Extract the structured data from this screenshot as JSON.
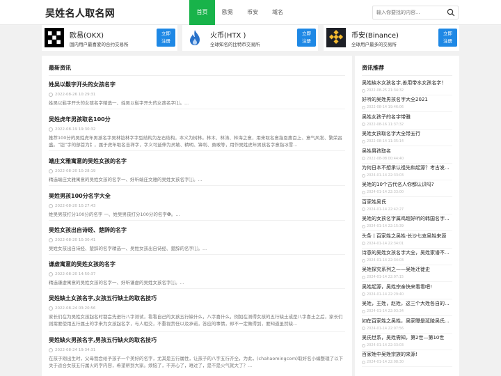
{
  "header": {
    "logo": "吴姓名人取名网",
    "nav": [
      "首页",
      "欧易",
      "币安",
      "域名"
    ],
    "search_placeholder": "输入你要找的内容..."
  },
  "exchanges": [
    {
      "name": "欧易(OKX)",
      "desc": "国内用户最喜爱的合约交易所",
      "button": [
        "立即",
        "注册"
      ],
      "icon": "okx-logo"
    },
    {
      "name": "火币(HTX )",
      "desc": "全球知名的比特币交易所",
      "button": [
        "立即",
        "注册"
      ],
      "icon": "htx-flame-logo"
    },
    {
      "name": "币安(Binance)",
      "desc": "全球用户最多的交易所",
      "button": [
        "立即",
        "注册"
      ],
      "icon": "binance-logo"
    }
  ],
  "colors": {
    "accent": "#18b34a",
    "button": "#1e88e5"
  },
  "latest": {
    "title": "最新资讯",
    "articles": [
      {
        "title": "姓吴以鬏字开头的女孩名字",
        "date": "2022-08-26 10:29:31",
        "desc": "姓吴以鬏字开头的女孩名字精选一、姓吴以鬏字开头的女孩名字⑴。..."
      },
      {
        "title": "吴姓虎年男孩取名100分",
        "date": "2022-08-19 19:30:32",
        "desc": "推荐100分的吴姓虎年男孩名字吴林铠林字字型结构为左右结构，本义为树林。林木、林涛、林海之意，用来取名意指恩惠百上、意气风发、繁荣昌盛。“铠”字的部首为钅，属于虎年取名吉祥字，字义可延伸为灵敏、精明、锋利、勇敢等，用作吴姓虎年男孩名字意指冰雪..."
      },
      {
        "title": "端庄文雅寓意的吴姓女孩的名字",
        "date": "2022-08-20 10:28:19",
        "desc": "精选端庄文雅寓意的吴姓女孩的名字一、好听端庄文雅的吴姓女孩名字⑴。..."
      },
      {
        "title": "吴姓男孩100分名字大全",
        "date": "2022-08-20 10:27:43",
        "desc": "姓吴男孩打分100分的名字 一、姓吴男孩打分100分的名字❶。..."
      },
      {
        "title": "吴姓女孩出自诗经、楚辞的名字",
        "date": "2022-08-20 10:30:41",
        "desc": "吴姓女孩出自诗经、楚辞的名字精选一、吴姓女孩出自诗经、楚辞的名字⑴。..."
      },
      {
        "title": "谦虚寓意的吴姓女孩的名字",
        "date": "2022-08-20 14:50:37",
        "desc": "精选谦虚寓意的吴姓女孩的名字一、好听谦虚的吴姓女孩名字⑴。..."
      },
      {
        "title": "吴姓缺土女孩名字,女孩五行缺土的取名技巧",
        "date": "2022-08-24 03:20:56",
        "desc": "家长们在为吴姓女孩起名时都会先进行八字测试，看看自己的女孩五行缺什么，八字喜什么，例如在测得女孩的五行缺土或是八字喜土之后，家长们则需要使用五行属土的字来为女孩起名字，与人相交，不重视责任以及承诺，答应的事情，却不一定做得到，要知道虽然缺..."
      },
      {
        "title": "吴姓缺火男孩名字,男孩五行缺火的取名技巧",
        "date": "2022-08-24 19:34:31",
        "desc": "在孩子刚出生时，父母我会给予孩子一个美好的名字，尤其是五行属性，让孩子的八字五行齐全，为此，(chahaomingcom)取好名小编整理了以下关于适合女孩五行属火的字内容，希望帮到大家。烦恼了，不开心了，难过了，是不是火气就大了？..."
      }
    ]
  },
  "recommend": {
    "title": "资讯推荐",
    "items": [
      {
        "title": "吴姓缺水女孩名字,善用带水女孩名字！",
        "date": "2022-08-25 21:34:32"
      },
      {
        "title": "好听的吴姓男孩名字大全2021",
        "date": "2022-08-14 19:46:06"
      },
      {
        "title": "吴姓女孩子的名字带雅",
        "date": "2022-08-16 11:37:32"
      },
      {
        "title": "吴姓女孩取名字大全带五行",
        "date": "2022-08-14 11:35:14"
      },
      {
        "title": "吴姓男孩取名",
        "date": "2022-08-08 00:44:40"
      },
      {
        "title": "为何日本不想承认祖先和起源？考古发...",
        "date": "2024-01-14 22:33:03"
      },
      {
        "title": "吴姓的10个古代名人你都认识吗?",
        "date": "2024-01-14 22:33:00"
      },
      {
        "title": "百家姓吴氏",
        "date": "2024-01-14 22:42:27"
      },
      {
        "title": "吴姓的女孩名字属鸡超好听的韩国名字...",
        "date": "2024-01-14 22:15:39"
      },
      {
        "title": "头条丨百家姓之吴姓·长沙七支吴姓来源",
        "date": "2024-01-14 22:34:01"
      },
      {
        "title": "诗意的吴姓女孩名字大全，吴姓家谱不...",
        "date": "2024-01-14 22:34:03"
      },
      {
        "title": "吴姓探究系列之——吴姓迁徙史",
        "date": "2024-01-14 22:07:15"
      },
      {
        "title": "吴姓起源，吴姓宗亲快来看看吧!",
        "date": "2024-01-14 22:29:40"
      },
      {
        "title": "吴姓，王姓，赵姓，这三个大姓各自的...",
        "date": "2024-01-14 22:03:34"
      },
      {
        "title": "如在百家姓之吴姓，吴家曝是延陵吴氏...",
        "date": "2024-01-14 22:07:56"
      },
      {
        "title": "吴氏世系，吴姓需知，第2世—第10世",
        "date": "2024-01-14 22:33:03"
      },
      {
        "title": "百家姓中吴姓宗族的来源!",
        "date": "2024-01-14 22:08:30"
      }
    ]
  }
}
